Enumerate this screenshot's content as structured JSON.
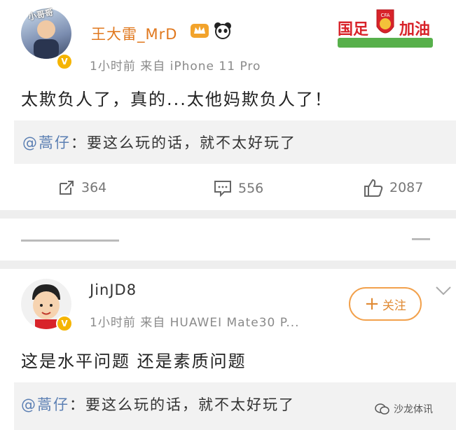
{
  "post1": {
    "username": "王大雷_MrD",
    "avatar_caption": "小哥哥",
    "meta": "1小时前  来自 iPhone 11 Pro",
    "content": "太欺负人了，真的...太他妈欺负人了！",
    "banner": {
      "left": "国足",
      "right": "加油"
    },
    "repost": {
      "mention": "@蒿仔",
      "text": "：要这么玩的话，就不太好玩了"
    },
    "actions": {
      "repost_count": "364",
      "comment_count": "556",
      "like_count": "2087"
    }
  },
  "post2": {
    "username": "JinJD8",
    "meta": "1小时前  来自 HUAWEI Mate30 P...",
    "follow_label": "关注",
    "content": "这是水平问题 还是素质问题",
    "repost": {
      "mention": "@蒿仔",
      "text": "：要这么玩的话，就不太好玩了"
    }
  },
  "watermark": "沙龙体讯",
  "colors": {
    "accent": "#e08a34",
    "mention": "#5b7fb3",
    "vip": "#f5b400"
  }
}
